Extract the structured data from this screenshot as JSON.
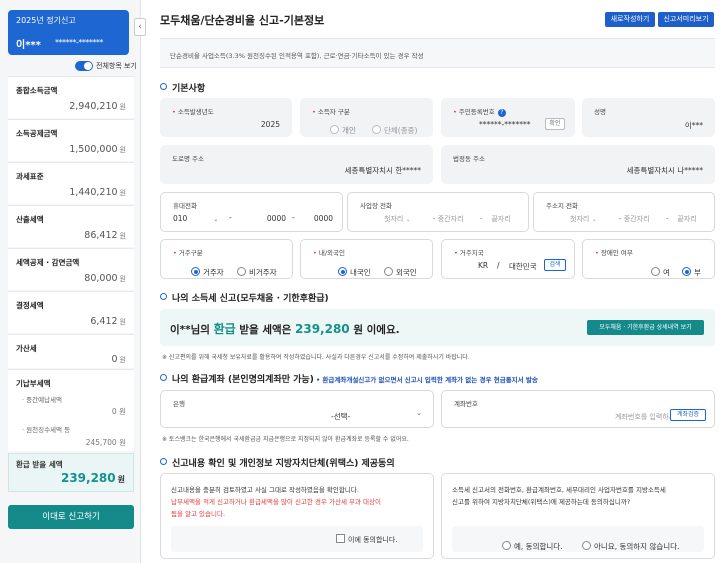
{
  "sidebar": {
    "card": {
      "title": "2025년 정기신고",
      "name": "이***",
      "rrn": "******-*******"
    },
    "toggle_label": "전체항목 보기",
    "items": [
      {
        "label": "종합소득금액",
        "value": "2,940,210",
        "unit": "원"
      },
      {
        "label": "소득공제금액",
        "value": "1,500,000",
        "unit": "원"
      },
      {
        "label": "과세표준",
        "value": "1,440,210",
        "unit": "원"
      },
      {
        "label": "산출세액",
        "value": "86,412",
        "unit": "원"
      },
      {
        "label": "세액공제 · 감면금액",
        "value": "80,000",
        "unit": "원"
      },
      {
        "label": "결정세액",
        "value": "6,412",
        "unit": "원"
      },
      {
        "label": "가산세",
        "value": "0",
        "unit": "원"
      },
      {
        "label": "기납부세액",
        "value": "",
        "unit": ""
      }
    ],
    "prepaid_sub": [
      {
        "label": "중간예납세액",
        "value": "0",
        "unit": "원"
      },
      {
        "label": "원천징수세액 등",
        "value": "245,700",
        "unit": "원"
      }
    ],
    "refund": {
      "label": "환급 받을 세액",
      "value": "239,280",
      "unit": "원"
    },
    "submit_label": "이대로 신고하기"
  },
  "header": {
    "title": "모두채움/단순경비율 신고-기본정보",
    "btn_new": "새로작성하기",
    "btn_preview": "신고서미리보기"
  },
  "notice": "단순경비율 사업소득(3.3% 원천징수된 인적용역 포함), 근로·연금·기타소득이 있는 경우 작성",
  "basic": {
    "section": "기본사항",
    "year_label": "소득발생년도",
    "year_value": "2025",
    "person_label": "소득자 구분",
    "person_opt1": "개인",
    "person_opt2": "단체(종중)",
    "rrn_label": "주민등록번호",
    "rrn_value": "******-*******",
    "rrn_btn": "확인",
    "name_label": "성명",
    "name_value": "이***",
    "road_label": "도로명 주소",
    "road_value": "세종특별자치시 한*****",
    "legal_label": "법정동 주소",
    "legal_value": "세종특별자치시 나*****",
    "mobile_label": "휴대전화",
    "mobile_1": "010",
    "mobile_sep": "-",
    "mobile_2": "0000",
    "mobile_3": "0000",
    "biz_label": "사업장 전화",
    "home_label": "주소지 전화",
    "ph1": "첫자리",
    "ph2": "중간자리",
    "ph3": "끝자리",
    "residence_label": "거주구분",
    "residence_opt1": "거주자",
    "residence_opt2": "비거주자",
    "foreign_label": "내/외국인",
    "foreign_opt1": "내국인",
    "foreign_opt2": "외국인",
    "country_label": "거주지국",
    "country_code": "KR",
    "country_sep": "/",
    "country_name": "대한민국",
    "country_btn": "검색",
    "disabled_label": "장애인 여부",
    "disabled_opt1": "여",
    "disabled_opt2": "부"
  },
  "refund_section": {
    "section": "나의 소득세 신고(모두채움 · 기한후환급)",
    "name": "이**님의",
    "word": "환급",
    "mid": "받을 세액은",
    "amount": "239,280",
    "tail": "원 이에요.",
    "btn": "모두채움 · 기한후환급 상세내역 보기",
    "note": "※ 신고편의를 위해 국세청 보유자료를 활용하여 작성하였습니다. 사실과 다른경우 신고서를 수정하여 제출하시기 바랍니다."
  },
  "account": {
    "section": "나의 환급계좌 (본인명의계좌만 가능)",
    "section_note": "• 환급계좌개설신고가 없으면서 신고시 입력한 계좌가 없는 경우 현금통지서 발송",
    "bank_label": "은행",
    "bank_value": "-선택-",
    "acct_label": "계좌번호",
    "acct_placeholder": "계좌번호를 입력하세요",
    "acct_btn": "계좌검증",
    "note": "※ 토스뱅크는 한국은행에서 국세환급금 지급은행으로 지정되지 않아 환급계좌로 등록할 수 없어요."
  },
  "consent": {
    "section": "신고내용 확인 및 개인정보 지방자치단체(위택스) 제공동의",
    "left_text": "신고내용을 충분히 검토하였고 사실 그대로 작성하였음을 확인합니다.",
    "left_warn1": "납부세액을 적게 신고하거나 환급세액을 많이 신고한 경우 가산세 부과 대상이",
    "left_warn2": "됨을 알고 있습니다.",
    "left_check": "이에 동의합니다.",
    "right_text1": "소득세 신고서의 전화번호, 환급계좌번호, 세무대리인 사업자번호를 지방소득세",
    "right_text2": "신고를 위하여 지방자치단체(위택스)에 제공하는데 동의하십니까?",
    "right_opt1": "예, 동의합니다.",
    "right_opt2": "아니요, 동의하지 않습니다."
  }
}
